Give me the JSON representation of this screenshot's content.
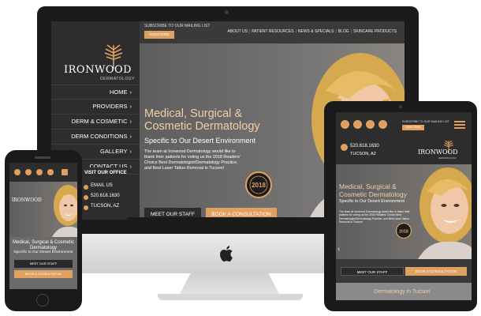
{
  "colors": {
    "accent": "#e0a060",
    "dark": "#2d2d2d",
    "headline": "#f2cfa5"
  },
  "desktop": {
    "logo": {
      "name": "IRONWOOD",
      "sub": "DERMATOLOGY",
      "icon": "wheat-logo-icon"
    },
    "subscribe_label": "SUBSCRIBE TO OUR MAILING LIST",
    "subscribe_button": "SUBSCRIBE",
    "top_nav": [
      "ABOUT US",
      "PATIENT RESOURCES",
      "NEWS & SPECIALS",
      "BLOG",
      "SKINCARE PRODUCTS"
    ],
    "side_nav": [
      "HOME",
      "PROVIDERS",
      "DERM & COSMETIC",
      "DERM CONDITIONS",
      "GALLERY",
      "CONTACT US"
    ],
    "contact": {
      "title": "VISIT OUR OFFICE",
      "email": "EMAIL US",
      "phone": "520.618.1630",
      "city": "TUCSON, AZ"
    },
    "headline": "Medical, Surgical & Cosmetic Dermatology",
    "subheadline": "Specific to Our Desert Environment",
    "paragraph": "The team at Ironwood Dermatology would like to thank their patients for voting us the 2018 Readers' Choice Best Dermatologist/Dermatology Practice, and Best Laser Tattoo Removal in Tucson!",
    "badge": "2018",
    "button_staff": "MEET OUR STAFF",
    "button_consult": "BOOK A CONSULTATION"
  },
  "tablet": {
    "subscribe_label": "SUBSCRIBE TO OUR MAILING LIST",
    "subscribe_button": "SUBSCRIBE",
    "phone": "520.618.1630",
    "city": "TUCSON, AZ",
    "logo": {
      "name": "IRONWOOD",
      "sub": "DERMATOLOGY"
    },
    "headline": "Medical, Surgical & Cosmetic Dermatology",
    "subheadline": "Specific to Our Desert Environment",
    "paragraph": "The team at Ironwood Dermatology would like to thank their patients for voting us the 2018 Readers' Choice Best Dermatologist/Dermatology Practice, and Best Laser Tattoo Removal in Tucson!",
    "badge": "2018",
    "button_staff": "MEET OUR STAFF",
    "button_consult": "BOOK A CONSULTATION",
    "footer": "Dermatology in Tucson"
  },
  "phone": {
    "logo": {
      "name": "IRONWOOD"
    },
    "headline": "Medical, Surgical & Cosmetic Dermatology",
    "subheadline": "Specific to Our Desert Environment",
    "button_staff": "MEET OUR STAFF",
    "button_consult": "BOOK A CONSULTATION"
  }
}
